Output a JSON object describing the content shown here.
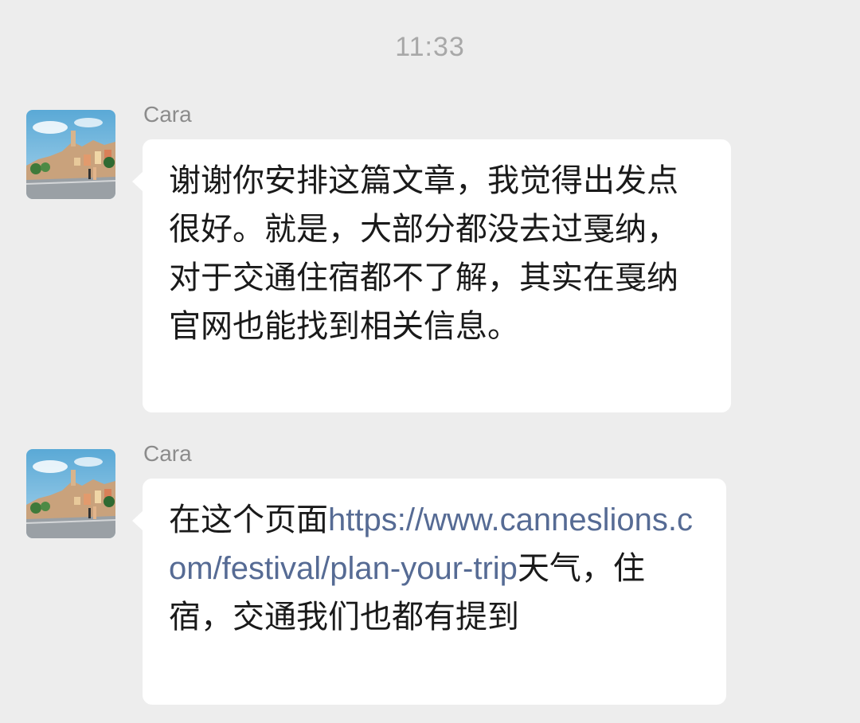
{
  "chat": {
    "timestamp": "11:33",
    "messages": [
      {
        "sender": "Cara",
        "text": "谢谢你安排这篇文章，我觉得出发点很好。就是，大部分都没去过戛纳，对于交通住宿都不了解，其实在戛纳官网也能找到相关信息。"
      },
      {
        "sender": "Cara",
        "text_before_link": "在这个页面",
        "link": "https://www.canneslions.com/festival/plan-your-trip",
        "text_after_link": "天气，住宿，交通我们也都有提到"
      }
    ]
  },
  "colors": {
    "background": "#ededed",
    "bubble": "#ffffff",
    "link": "#566b94",
    "timestamp": "#a8a8a8",
    "sender": "#8c8c8c"
  }
}
